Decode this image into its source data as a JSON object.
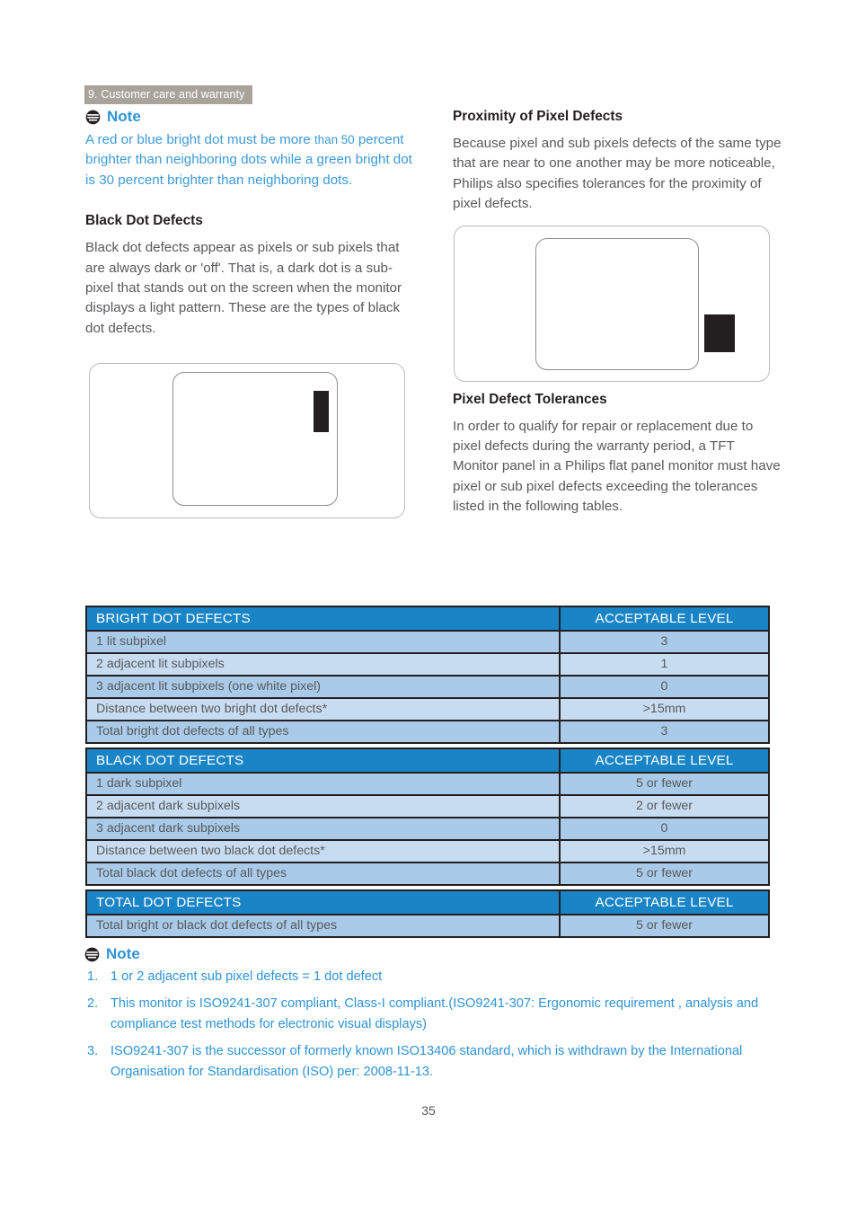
{
  "running_head": "9. Customer care and warranty",
  "left_column": {
    "note": {
      "icon": "note-icon",
      "title": "Note",
      "text_main": "A red or blue bright dot must be more ",
      "text_small": "than 50",
      "text_rest": " percent brighter than neighboring dots while a green bright dot is 30 percent brighter than neighboring dots."
    },
    "section_heading": "Black Dot Defects",
    "section_body": "Black dot defects appear as pixels or sub pixels that are always dark or 'off'. That is, a dark dot is a sub-pixel that stands out on the screen when the monitor displays a light pattern. These are the types of black dot defects."
  },
  "right_column": {
    "heading_proximity": "Proximity of Pixel Defects",
    "body_proximity": "Because pixel and sub pixels defects of the same type that are near to one another may be more noticeable, Philips also specifies tolerances for the proximity of pixel defects.",
    "heading_tolerances": "Pixel Defect Tolerances",
    "body_tolerances": "In order to qualify for repair or replacement due to pixel defects during the warranty period, a TFT Monitor panel in a Philips flat panel monitor must have pixel or sub pixel defects exceeding the tolerances listed in the following tables."
  },
  "diagrams": {
    "black_dot": "black-dot-defect-illustration",
    "proximity": "proximity-defect-illustration"
  },
  "colors": {
    "header_blue": "#1a85c6",
    "row_odd": "#a9cbe9",
    "row_even": "#c8dcf1",
    "note_blue": "#2e93d6",
    "running_head_gray": "#a9a39c"
  },
  "tables": [
    {
      "id": "bright-dot-defects",
      "header_left": "BRIGHT DOT DEFECTS",
      "header_right": "ACCEPTABLE LEVEL",
      "rows": [
        {
          "label": "1 lit subpixel",
          "level": "3"
        },
        {
          "label": "2 adjacent lit subpixels",
          "level": "1"
        },
        {
          "label": "3 adjacent lit subpixels (one white pixel)",
          "level": "0"
        },
        {
          "label": "Distance between two bright dot defects*",
          "level": ">15mm"
        },
        {
          "label": "Total bright dot defects of all types",
          "level": "3"
        }
      ]
    },
    {
      "id": "black-dot-defects",
      "header_left": "BLACK DOT DEFECTS",
      "header_right": "ACCEPTABLE LEVEL",
      "rows": [
        {
          "label": "1 dark subpixel",
          "level": "5 or fewer"
        },
        {
          "label": "2 adjacent dark subpixels",
          "level": "2 or fewer"
        },
        {
          "label": "3 adjacent dark subpixels",
          "level": "0"
        },
        {
          "label": "Distance between two black dot defects*",
          "level": ">15mm"
        },
        {
          "label": "Total black dot defects of all types",
          "level": "5 or fewer"
        }
      ]
    },
    {
      "id": "total-dot-defects",
      "header_left": "TOTAL DOT DEFECTS",
      "header_right": "ACCEPTABLE LEVEL",
      "rows": [
        {
          "label": "Total bright or black dot defects of all types",
          "level": "5 or fewer"
        }
      ]
    }
  ],
  "bottom_notes": {
    "icon": "note-icon",
    "title": "Note",
    "items": [
      "1 or 2 adjacent sub pixel defects = 1 dot defect",
      "This monitor is ISO9241-307 compliant, Class-I compliant.(ISO9241-307: Ergonomic requirement , analysis and compliance test methods for electronic visual displays)",
      "ISO9241-307 is the successor of formerly known ISO13406 standard, which is withdrawn by the International Organisation for Standardisation (ISO) per: 2008-11-13."
    ]
  },
  "folio": "35"
}
